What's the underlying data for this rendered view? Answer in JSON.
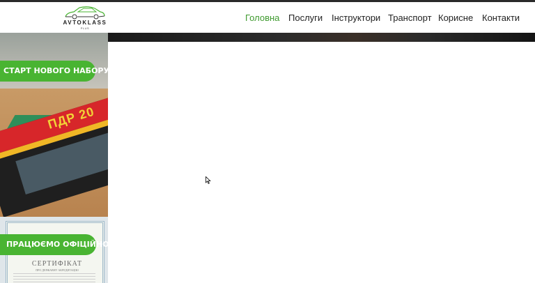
{
  "header": {
    "logo": {
      "brand": "AVTOKLASS",
      "sub": "PLUS"
    },
    "nav": [
      {
        "label": "Головна",
        "active": true
      },
      {
        "label": "Послуги",
        "active": false
      },
      {
        "label": "Інструктори",
        "active": false
      },
      {
        "label": "Транспорт",
        "active": false
      },
      {
        "label": "Корисне",
        "active": false
      },
      {
        "label": "Контакти",
        "active": false
      }
    ]
  },
  "promo": {
    "new_enrollment_label": "СТАРТ НОВОГО НАБОРУ",
    "official_label": "ПРАЦЮЄМО ОФІЦІЙНО",
    "book_text": "ПДР 20",
    "certificate_title": "СЕРТИФІКАТ",
    "certificate_subtitle": "ПРО ДЕРЖАВНУ АКРЕДИТАЦІЮ"
  },
  "colors": {
    "accent": "#49b432",
    "nav_active": "#3f9a2f",
    "nav_text": "#222222"
  },
  "icons": [
    "car-logo-icon",
    "mouse-cursor-icon"
  ]
}
